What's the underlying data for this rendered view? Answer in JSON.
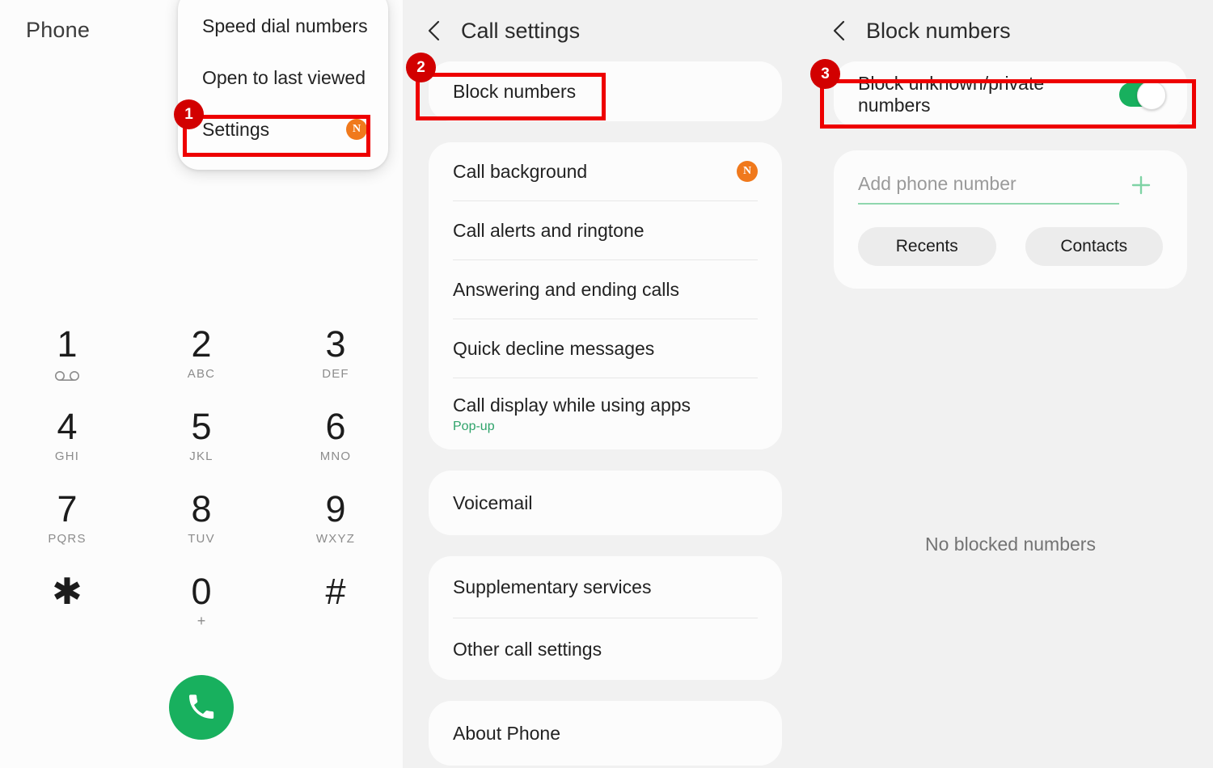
{
  "left_panel": {
    "app_title": "Phone",
    "dropdown": {
      "items": [
        {
          "label": "Speed dial numbers",
          "badge": ""
        },
        {
          "label": "Open to last viewed",
          "badge": ""
        },
        {
          "label": "Settings",
          "badge": "N"
        }
      ]
    },
    "dialpad": [
      {
        "digit": "1",
        "sub": "",
        "icon": "voicemail-icon"
      },
      {
        "digit": "2",
        "sub": "ABC",
        "icon": ""
      },
      {
        "digit": "3",
        "sub": "DEF",
        "icon": ""
      },
      {
        "digit": "4",
        "sub": "GHI",
        "icon": ""
      },
      {
        "digit": "5",
        "sub": "JKL",
        "icon": ""
      },
      {
        "digit": "6",
        "sub": "MNO",
        "icon": ""
      },
      {
        "digit": "7",
        "sub": "PQRS",
        "icon": ""
      },
      {
        "digit": "8",
        "sub": "TUV",
        "icon": ""
      },
      {
        "digit": "9",
        "sub": "WXYZ",
        "icon": ""
      },
      {
        "digit": "✱",
        "sub": "",
        "icon": ""
      },
      {
        "digit": "0",
        "sub": "+",
        "icon": ""
      },
      {
        "digit": "#",
        "sub": "",
        "icon": ""
      }
    ],
    "call_button": {
      "icon": "phone-handset-icon",
      "color": "#18b05e"
    }
  },
  "mid_panel": {
    "header": {
      "back_icon": "chevron-left-icon",
      "title": "Call settings"
    },
    "groups": [
      {
        "rows": [
          {
            "label": "Block numbers",
            "sub": "",
            "badge": ""
          }
        ]
      },
      {
        "rows": [
          {
            "label": "Call background",
            "sub": "",
            "badge": "N"
          },
          {
            "label": "Call alerts and ringtone",
            "sub": "",
            "badge": ""
          },
          {
            "label": "Answering and ending calls",
            "sub": "",
            "badge": ""
          },
          {
            "label": "Quick decline messages",
            "sub": "",
            "badge": ""
          },
          {
            "label": "Call display while using apps",
            "sub": "Pop-up",
            "badge": ""
          }
        ]
      },
      {
        "rows": [
          {
            "label": "Voicemail",
            "sub": "",
            "badge": ""
          }
        ]
      },
      {
        "rows": [
          {
            "label": "Supplementary services",
            "sub": "",
            "badge": ""
          },
          {
            "label": "Other call settings",
            "sub": "",
            "badge": ""
          }
        ]
      },
      {
        "rows": [
          {
            "label": "About Phone",
            "sub": "",
            "badge": ""
          }
        ]
      }
    ]
  },
  "right_panel": {
    "header": {
      "back_icon": "chevron-left-icon",
      "title": "Block numbers"
    },
    "toggle_row": {
      "label": "Block unknown/private numbers",
      "state": "on",
      "color": "#18b05e"
    },
    "add_number": {
      "placeholder": "Add phone number",
      "value": "",
      "add_icon": "plus-icon",
      "chips": [
        "Recents",
        "Contacts"
      ]
    },
    "empty_state": "No blocked numbers"
  },
  "callouts": [
    {
      "number": "1",
      "target": "settings-menu-item"
    },
    {
      "number": "2",
      "target": "block-numbers-row"
    },
    {
      "number": "3",
      "target": "block-unknown-private-numbers-row"
    }
  ],
  "colors": {
    "accent_red": "#ee0000",
    "badge_red": "#d20000",
    "new_badge_orange": "#f0791c",
    "toggle_green": "#18b05e",
    "sub_green": "#2ea36a",
    "panel_bg": "#f1f1f1",
    "card_bg": "#fcfcfc"
  }
}
